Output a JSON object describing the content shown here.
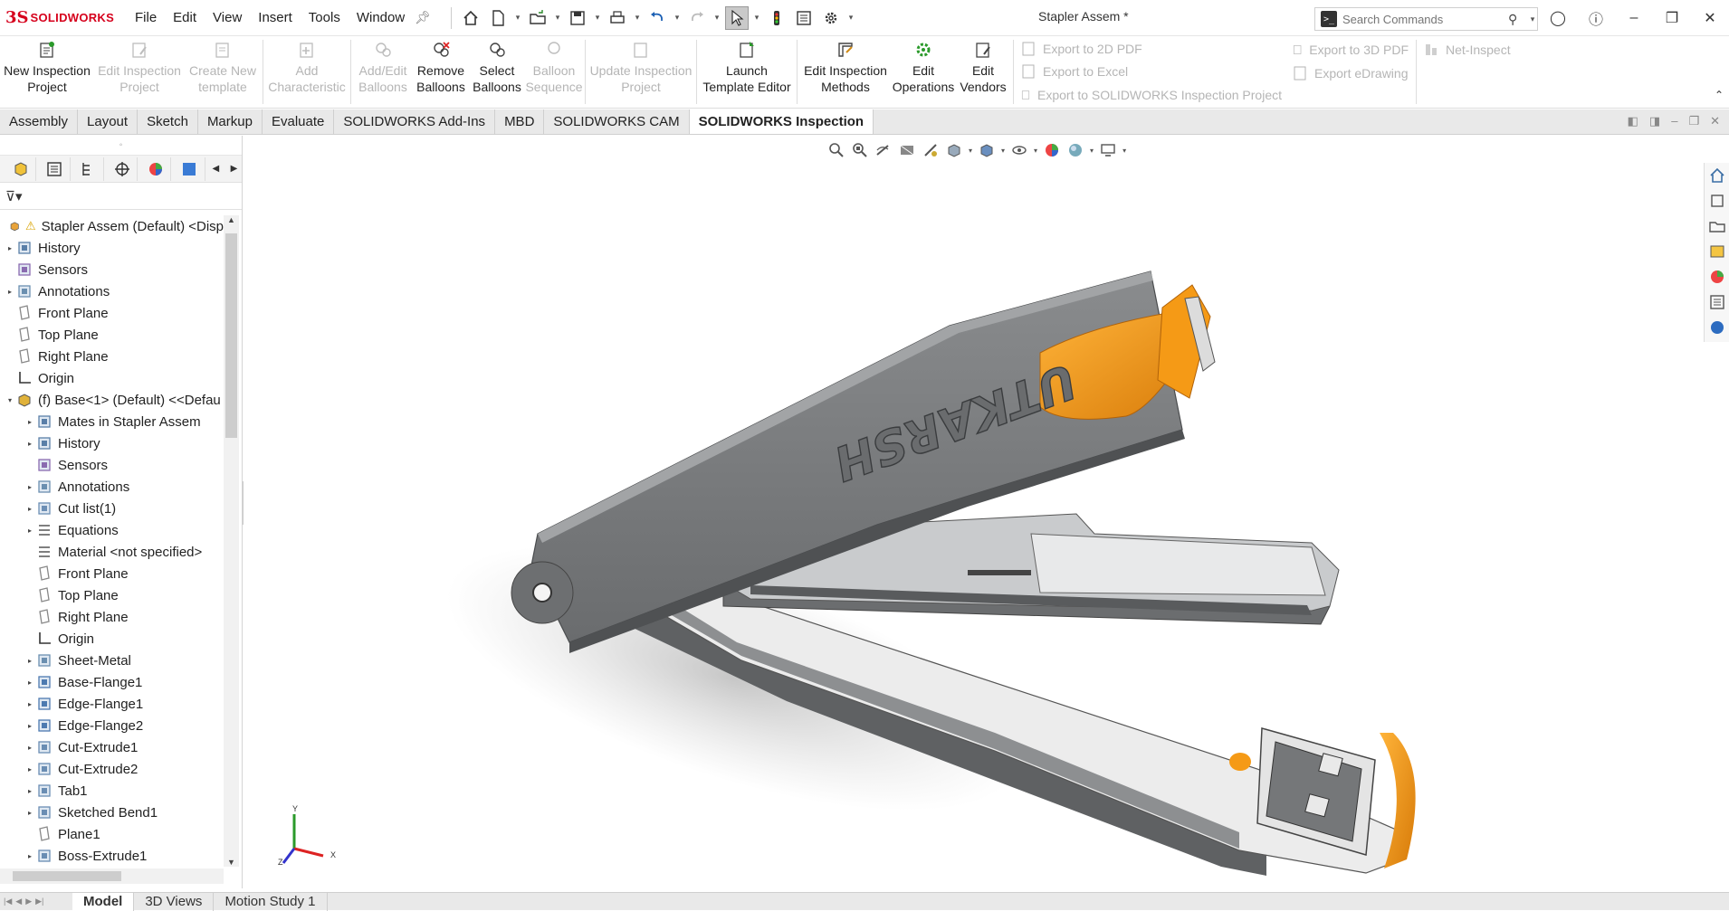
{
  "app": {
    "brand": "SOLIDWORKS",
    "doc_title": "Stapler Assem *"
  },
  "menu": [
    "File",
    "Edit",
    "View",
    "Insert",
    "Tools",
    "Window"
  ],
  "search": {
    "placeholder": "Search Commands"
  },
  "ribbon": {
    "buttons": [
      {
        "line1": "New Inspection",
        "line2": "Project",
        "enabled": true
      },
      {
        "line1": "Edit Inspection",
        "line2": "Project",
        "enabled": false
      },
      {
        "line1": "Create New",
        "line2": "template",
        "enabled": false
      },
      {
        "line1": "Add",
        "line2": "Characteristic",
        "enabled": false
      },
      {
        "line1": "Add/Edit",
        "line2": "Balloons",
        "enabled": false
      },
      {
        "line1": "Remove",
        "line2": "Balloons",
        "enabled": true
      },
      {
        "line1": "Select",
        "line2": "Balloons",
        "enabled": true
      },
      {
        "line1": "Balloon",
        "line2": "Sequence",
        "enabled": false
      },
      {
        "line1": "Update Inspection",
        "line2": "Project",
        "enabled": false
      },
      {
        "line1": "Launch",
        "line2": "Template Editor",
        "enabled": true
      },
      {
        "line1": "Edit Inspection",
        "line2": "Methods",
        "enabled": true
      },
      {
        "line1": "Edit",
        "line2": "Operations",
        "enabled": true
      },
      {
        "line1": "Edit",
        "line2": "Vendors",
        "enabled": true
      }
    ],
    "exports_col1": [
      "Export to 2D PDF",
      "Export to Excel",
      "Export to SOLIDWORKS Inspection Project"
    ],
    "exports_col2": [
      "Export to 3D PDF",
      "Export eDrawing"
    ],
    "net_inspect": "Net-Inspect"
  },
  "tabs": [
    {
      "label": "Assembly",
      "active": false
    },
    {
      "label": "Layout",
      "active": false
    },
    {
      "label": "Sketch",
      "active": false
    },
    {
      "label": "Markup",
      "active": false
    },
    {
      "label": "Evaluate",
      "active": false
    },
    {
      "label": "SOLIDWORKS Add-Ins",
      "active": false
    },
    {
      "label": "MBD",
      "active": false
    },
    {
      "label": "SOLIDWORKS CAM",
      "active": false
    },
    {
      "label": "SOLIDWORKS Inspection",
      "active": true
    }
  ],
  "tree": [
    {
      "label": "Stapler Assem (Default) <Disp",
      "level": 0,
      "icon": "assembly-icon",
      "expander": ""
    },
    {
      "label": "History",
      "level": 1,
      "icon": "history-icon",
      "expander": "▸"
    },
    {
      "label": "Sensors",
      "level": 1,
      "icon": "sensor-icon",
      "expander": ""
    },
    {
      "label": "Annotations",
      "level": 1,
      "icon": "annotation-icon",
      "expander": "▸"
    },
    {
      "label": "Front Plane",
      "level": 1,
      "icon": "plane-icon",
      "expander": ""
    },
    {
      "label": "Top Plane",
      "level": 1,
      "icon": "plane-icon",
      "expander": ""
    },
    {
      "label": "Right Plane",
      "level": 1,
      "icon": "plane-icon",
      "expander": ""
    },
    {
      "label": "Origin",
      "level": 1,
      "icon": "origin-icon",
      "expander": ""
    },
    {
      "label": "(f) Base<1> (Default) <<Defau",
      "level": 1,
      "icon": "part-icon",
      "expander": "▾"
    },
    {
      "label": "Mates in Stapler Assem",
      "level": 2,
      "icon": "mates-icon",
      "expander": "▸"
    },
    {
      "label": "History",
      "level": 2,
      "icon": "history-icon",
      "expander": "▸"
    },
    {
      "label": "Sensors",
      "level": 2,
      "icon": "sensor-icon",
      "expander": ""
    },
    {
      "label": "Annotations",
      "level": 2,
      "icon": "annotation-icon",
      "expander": "▸"
    },
    {
      "label": "Cut list(1)",
      "level": 2,
      "icon": "cutlist-icon",
      "expander": "▸"
    },
    {
      "label": "Equations",
      "level": 2,
      "icon": "equations-icon",
      "expander": "▸"
    },
    {
      "label": "Material <not specified>",
      "level": 2,
      "icon": "material-icon",
      "expander": ""
    },
    {
      "label": "Front Plane",
      "level": 2,
      "icon": "plane-icon",
      "expander": ""
    },
    {
      "label": "Top Plane",
      "level": 2,
      "icon": "plane-icon",
      "expander": ""
    },
    {
      "label": "Right Plane",
      "level": 2,
      "icon": "plane-icon",
      "expander": ""
    },
    {
      "label": "Origin",
      "level": 2,
      "icon": "origin-icon",
      "expander": ""
    },
    {
      "label": "Sheet-Metal",
      "level": 2,
      "icon": "sheetmetal-icon",
      "expander": "▸"
    },
    {
      "label": "Base-Flange1",
      "level": 2,
      "icon": "flange-icon",
      "expander": "▸"
    },
    {
      "label": "Edge-Flange1",
      "level": 2,
      "icon": "flange-icon",
      "expander": "▸"
    },
    {
      "label": "Edge-Flange2",
      "level": 2,
      "icon": "flange-icon",
      "expander": "▸"
    },
    {
      "label": "Cut-Extrude1",
      "level": 2,
      "icon": "cut-icon",
      "expander": "▸"
    },
    {
      "label": "Cut-Extrude2",
      "level": 2,
      "icon": "cut-icon",
      "expander": "▸"
    },
    {
      "label": "Tab1",
      "level": 2,
      "icon": "tab-icon",
      "expander": "▸"
    },
    {
      "label": "Sketched Bend1",
      "level": 2,
      "icon": "bend-icon",
      "expander": "▸"
    },
    {
      "label": "Plane1",
      "level": 2,
      "icon": "plane-icon",
      "expander": ""
    },
    {
      "label": "Boss-Extrude1",
      "level": 2,
      "icon": "boss-icon",
      "expander": "▸"
    }
  ],
  "model": {
    "engraving": "UTKARSH"
  },
  "triad": {
    "x": "X",
    "y": "Y",
    "z": "Z"
  },
  "bottom_tabs": [
    {
      "label": "Model",
      "active": true
    },
    {
      "label": "3D Views",
      "active": false
    },
    {
      "label": "Motion Study 1",
      "active": false
    }
  ],
  "colors": {
    "accent_orange": "#f59a16",
    "body_gray": "#6d6f71",
    "brand_red": "#d6001c"
  }
}
